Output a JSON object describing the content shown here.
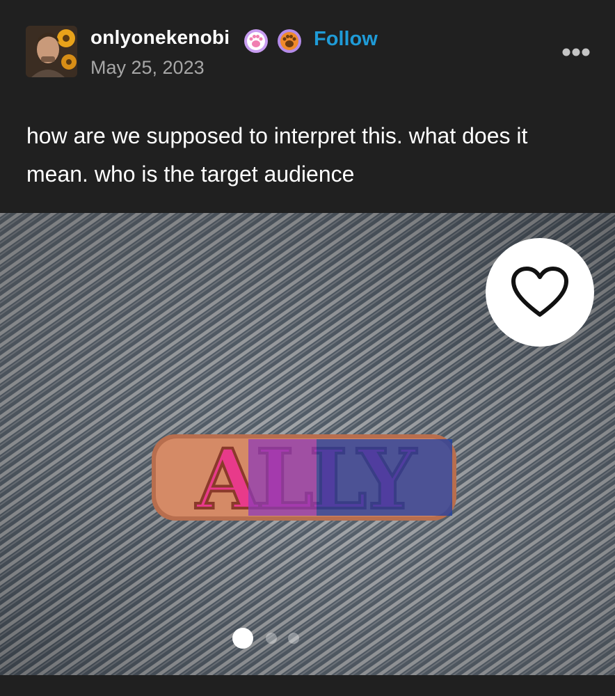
{
  "post": {
    "username": "onlyonekenobi",
    "follow_label": "Follow",
    "date": "May 25, 2023",
    "text": "how are we supposed to interpret this. what does it mean. who is the target audience"
  },
  "image": {
    "pin_text": "ALLY",
    "pin_colors": [
      "#e83a8a",
      "#8e3bb8",
      "#1e3fa6"
    ],
    "slide_count": 3,
    "active_slide": 1
  },
  "colors": {
    "background": "#202020",
    "follow": "#1f9bd7",
    "date": "#a7a7a7"
  }
}
